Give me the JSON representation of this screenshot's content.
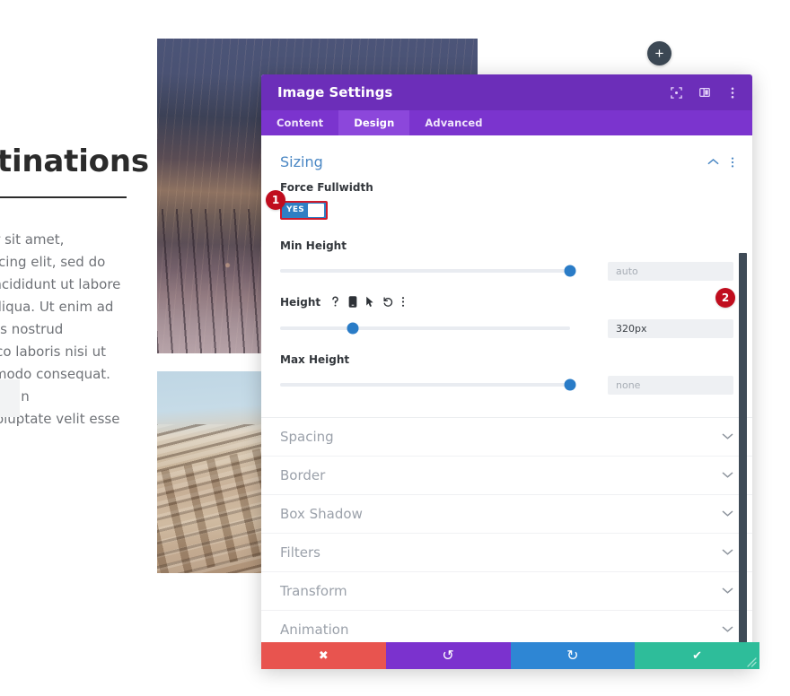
{
  "page": {
    "heading": "Destinations",
    "paragraph": "Lorem ipsum dolor sit amet, consectetur adipiscing elit, sed do eiusmod tempor incididunt ut labore et dolore magna aliqua. Ut enim ad minim veniam, quis nostrud exercitation ullamco laboris nisi ut aliquip ex ea commodo consequat. Duis aute irure dolor in reprehenderit in voluptate velit esse"
  },
  "canvas": {
    "add_button_label": "+",
    "add_button_icon": "plus-icon"
  },
  "modal": {
    "title": "Image Settings",
    "header_icons": [
      {
        "name": "expand-view-icon",
        "label": "Expand"
      },
      {
        "name": "split-view-icon",
        "label": "Split view"
      },
      {
        "name": "kebab-menu-icon",
        "label": "More options"
      }
    ],
    "tabs": [
      {
        "label": "Content",
        "active": false
      },
      {
        "label": "Design",
        "active": true
      },
      {
        "label": "Advanced",
        "active": false
      }
    ],
    "sizing": {
      "title": "Sizing",
      "collapse_icon": "chevron-up-icon",
      "menu_icon": "kebab-menu-icon",
      "force_fullwidth": {
        "label": "Force Fullwidth",
        "toggle_text": "YES",
        "state": "on",
        "badge": "1"
      },
      "min_height": {
        "label": "Min Height",
        "value": "auto",
        "is_placeholder": true,
        "slider_percent": 100
      },
      "height": {
        "label": "Height",
        "value": "320px",
        "is_placeholder": false,
        "slider_percent": 25,
        "badge": "2",
        "icons": [
          {
            "name": "help-icon",
            "glyph": "?"
          },
          {
            "name": "responsive-mobile-icon",
            "glyph": "mobile"
          },
          {
            "name": "hover-cursor-icon",
            "glyph": "cursor"
          },
          {
            "name": "reset-icon",
            "glyph": "undo"
          },
          {
            "name": "kebab-menu-icon",
            "glyph": "kebab"
          }
        ]
      },
      "max_height": {
        "label": "Max Height",
        "value": "none",
        "is_placeholder": true,
        "slider_percent": 100
      }
    },
    "sections": [
      {
        "label": "Spacing",
        "chevron": "chevron-down-icon"
      },
      {
        "label": "Border",
        "chevron": "chevron-down-icon"
      },
      {
        "label": "Box Shadow",
        "chevron": "chevron-down-icon"
      },
      {
        "label": "Filters",
        "chevron": "chevron-down-icon"
      },
      {
        "label": "Transform",
        "chevron": "chevron-down-icon"
      },
      {
        "label": "Animation",
        "chevron": "chevron-down-icon"
      }
    ],
    "footer": [
      {
        "name": "cancel-button",
        "icon": "close-icon",
        "glyph": "✖",
        "color": "#e8544f"
      },
      {
        "name": "undo-button",
        "icon": "undo-icon",
        "glyph": "↺",
        "color": "#7b32ce"
      },
      {
        "name": "redo-button",
        "icon": "redo-icon",
        "glyph": "↻",
        "color": "#2e86d4"
      },
      {
        "name": "save-button",
        "icon": "check-icon",
        "glyph": "✔",
        "color": "#2ebd9a"
      }
    ]
  },
  "colors": {
    "modal_header": "#6c2eb9",
    "tab_bar": "#7b34ce",
    "tab_active": "#8c47db",
    "section_title": "#4a87c4",
    "slider_knob": "#2a7cc7",
    "toggle_on": "#2f7fc4",
    "badge": "#c00d1e",
    "badge_outline": "#cf1a2b"
  }
}
